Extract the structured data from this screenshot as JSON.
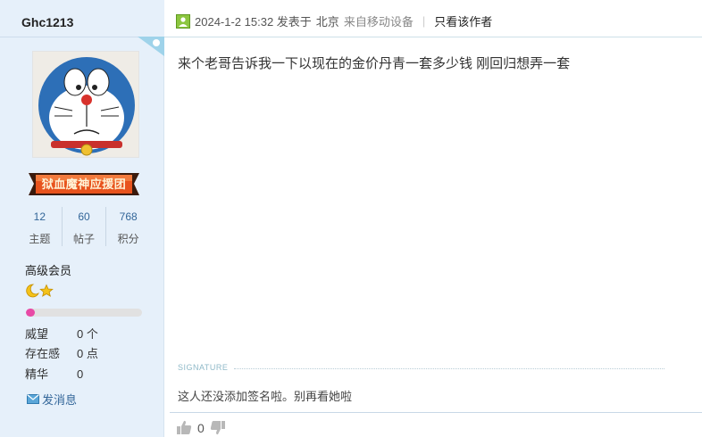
{
  "author": {
    "username": "Ghc1213",
    "badge": "狱血魔神应援团",
    "stats": [
      {
        "value": "12",
        "label": "主题"
      },
      {
        "value": "60",
        "label": "帖子"
      },
      {
        "value": "768",
        "label": "积分"
      }
    ],
    "level": "高级会员",
    "level_icons": [
      "moon-icon",
      "star-icon"
    ],
    "level_progress": 0.08,
    "info": [
      {
        "key": "威望",
        "value": "0 个"
      },
      {
        "key": "存在感",
        "value": "0 点"
      },
      {
        "key": "精华",
        "value": "0"
      }
    ],
    "send_message": "发消息"
  },
  "post": {
    "time": "2024-1-2 15:32 发表于",
    "location": "北京",
    "device": "来自移动设备",
    "separator": "|",
    "only_author": "只看该作者",
    "content": "来个老哥告诉我一下以现在的金价丹青一套多少钱 刚回归想弄一套",
    "signature_label": "SIGNATURE",
    "signature_text": "这人还没添加签名啦。别再看她啦",
    "like_count": "0"
  },
  "colors": {
    "sidebar_bg": "#e6f0fa",
    "link": "#336699",
    "progress": "#e84aa6",
    "badge": "#e8531d"
  }
}
